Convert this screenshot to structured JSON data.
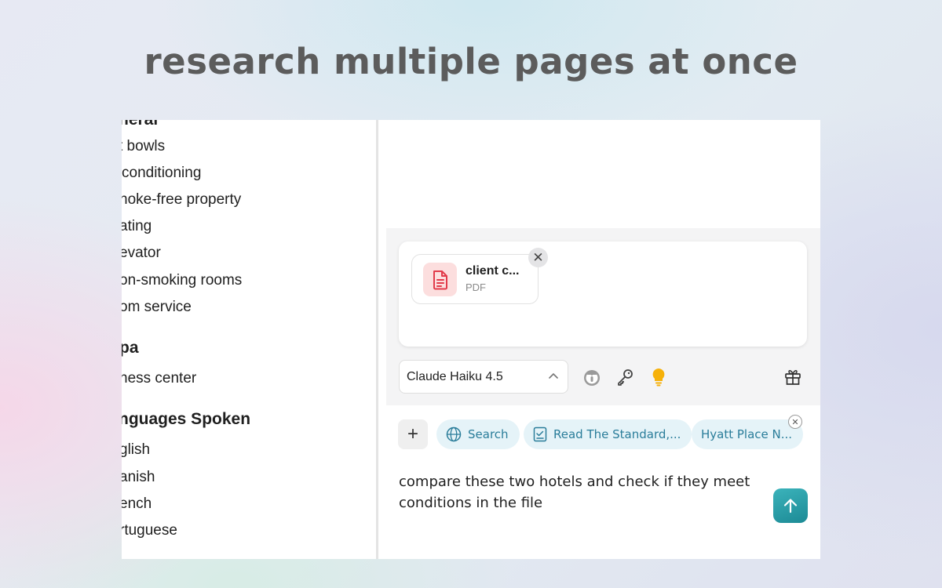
{
  "headline": "research multiple pages at once",
  "amenities": {
    "items": [
      {
        "text": "neral",
        "heading": true
      },
      {
        "text": "t bowls"
      },
      {
        "text": " conditioning"
      },
      {
        "text": "noke-free property"
      },
      {
        "text": "ating"
      },
      {
        "text": "evator"
      },
      {
        "text": "on-smoking rooms"
      },
      {
        "text": "om service"
      },
      {
        "text": "pa",
        "heading": true
      },
      {
        "text": "ness center"
      },
      {
        "text": "nguages Spoken",
        "heading": true
      },
      {
        "text": "glish"
      },
      {
        "text": "anish"
      },
      {
        "text": "ench"
      },
      {
        "text": "rtuguese"
      }
    ]
  },
  "attachment": {
    "name": "client c...",
    "type": "PDF",
    "close_glyph": "✕",
    "icon": "document-icon",
    "icon_color": "#e23b4a"
  },
  "toolbar": {
    "model": "Claude Haiku 4.5",
    "model_chevron": "^",
    "icons": [
      "incognito-icon",
      "key-icon",
      "lightbulb-icon",
      "gift-icon"
    ]
  },
  "context": {
    "plus_label": "+",
    "chips": [
      {
        "label": "Search",
        "icon": "globe-icon"
      },
      {
        "label": "Read The Standard,...",
        "icon": "checklist-icon"
      },
      {
        "label": "Hyatt Place N...",
        "icon": ""
      }
    ],
    "chip_close_glyph": "✕"
  },
  "prompt": {
    "text": "compare these two hotels and check if they meet conditions in the file"
  },
  "colors": {
    "accent": "#22a0aa",
    "chip_bg": "#e5f3f8",
    "chip_text": "#2a7d9a",
    "headline": "#5c5c5c"
  }
}
